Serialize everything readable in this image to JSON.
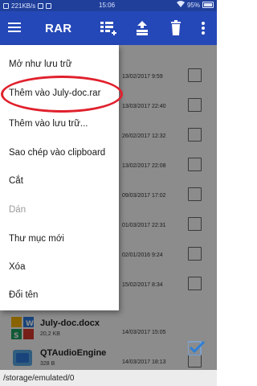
{
  "status_bar": {
    "speed": "221KB/s",
    "time": "15:06",
    "battery": "95%"
  },
  "toolbar": {
    "title": "RAR",
    "menu_icon": "hamburger-menu-icon",
    "add_files_icon": "add-files-icon",
    "extract_icon": "extract-upload-icon",
    "delete_icon": "trash-icon",
    "overflow_icon": "more-vert-icon"
  },
  "context_menu": {
    "items": [
      {
        "label": "Mở như lưu trữ",
        "enabled": true
      },
      {
        "label": "Thêm vào July-doc.rar",
        "enabled": true
      },
      {
        "label": "Thêm vào lưu trữ...",
        "enabled": true
      },
      {
        "label": "Sao chép vào clipboard",
        "enabled": true
      },
      {
        "label": "Cắt",
        "enabled": true
      },
      {
        "label": "Dán",
        "enabled": false
      },
      {
        "label": "Thư mục mới",
        "enabled": true
      },
      {
        "label": "Xóa",
        "enabled": true
      },
      {
        "label": "Đổi tên",
        "enabled": true
      }
    ]
  },
  "files": [
    {
      "date": "13/02/2017 9:59",
      "checked": false
    },
    {
      "date": "13/03/2017 22:40",
      "checked": false
    },
    {
      "date": "26/02/2017 12:32",
      "checked": false
    },
    {
      "date": "13/02/2017 22:08",
      "checked": false
    },
    {
      "date": "09/03/2017 17:02",
      "checked": false
    },
    {
      "date": "01/03/2017 22:31",
      "checked": false
    },
    {
      "date": "02/01/2016 9:24",
      "checked": false
    },
    {
      "date": "15/02/2017 8:34",
      "checked": false
    },
    {
      "name": "July-doc.docx",
      "size": "20,2 KB",
      "date": "14/03/2017 15:05",
      "checked": true
    },
    {
      "name": "QTAudioEngine",
      "size": "328 B",
      "date": "14/03/2017 18:13",
      "checked": false
    }
  ],
  "bottom_bar": {
    "path": "/storage/emulated/0"
  },
  "colors": {
    "toolbar": "#2548b8",
    "status_bar": "#1f3f9a",
    "highlight": "#e0202c",
    "checkbox_checked": "#2f7fd6"
  }
}
